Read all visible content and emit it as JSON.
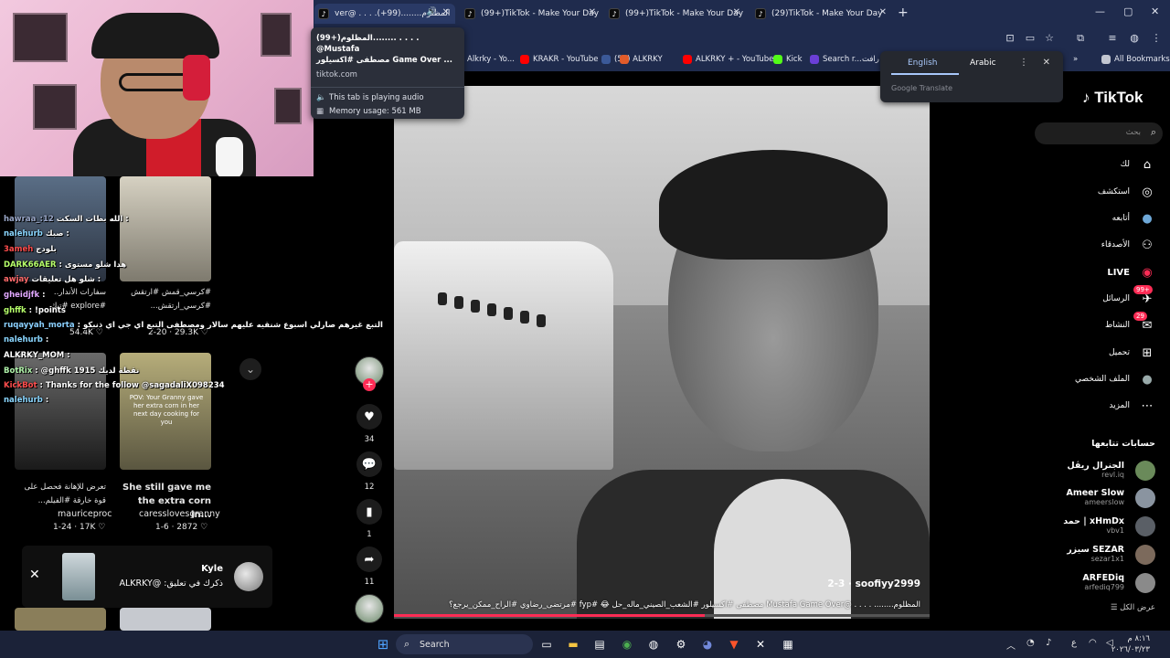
{
  "browser": {
    "tabs": [
      {
        "title": "ver@ . . . .المظلوم........(99+)",
        "active": true
      },
      {
        "title": "(99+)TikTok - Make Your Day"
      },
      {
        "title": "(99+)TikTok - Make Your Day"
      },
      {
        "title": "(29)TikTok - Make Your Day"
      }
    ],
    "new_tab": "+",
    "bookmarks": [
      "Alkrky - Yo...",
      "KRAKR - YouTube",
      "(50) ALKRKY",
      "ALKRKY + - YouTube",
      "Kick",
      "Search r...",
      "رافت",
      "All Bookmarks"
    ],
    "win_controls": [
      "—",
      "▢",
      "✕"
    ]
  },
  "hovercard": {
    "title": "(99+)المظلوم........ . . . . @Mustafa",
    "title2": "مصطفى #اكسيلور Game Over ...",
    "domain": "tiktok.com",
    "audio": "This tab is playing audio",
    "memory": "Memory usage: 561 MB"
  },
  "translate": {
    "lang_from": "English",
    "lang_to": "Arabic",
    "placeholder": "Google Translate",
    "close": "✕",
    "menu": "⋮"
  },
  "chat": [
    {
      "user": "hawraa_:12",
      "user_class": "u1",
      "text": "الله بطات السكت :"
    },
    {
      "user": "nalehurb",
      "user_class": "u2",
      "text": "صبك :"
    },
    {
      "user": "3ameh",
      "user_class": "u3",
      "text": "بلودج"
    },
    {
      "user": "DARK66AER",
      "user_class": "u4",
      "text": ": هدا شلو مستوى"
    },
    {
      "user": "awjay",
      "user_class": "u5",
      "text": "شلو هل تعليقات :"
    },
    {
      "user": "gheidjfk",
      "user_class": "u6",
      "text": ":"
    },
    {
      "user": "ghffk",
      "user_class": "u4",
      "text": ": !points"
    },
    {
      "user": "ruqayyah_morta",
      "user_class": "u9",
      "text": ": التبع غيرهم صارلي اسبوع شنقيه عليهم سالار ومصطفى التبع اي جي اي ذنبكو"
    },
    {
      "user": "nalehurb",
      "user_class": "u2",
      "text": ":"
    },
    {
      "user": "ALKRKY_MOM",
      "user_class": "u7",
      "text": ":"
    },
    {
      "user": "BotRix",
      "user_class": "u8",
      "text": ": @ghffk 1915 نقطة لديك"
    },
    {
      "user": "KickBot",
      "user_class": "u3",
      "text": ": Thanks for the follow @sagadaliX098234"
    },
    {
      "user": "nalehurb",
      "user_class": "u2",
      "text": ":"
    }
  ],
  "grid": {
    "items": [
      {
        "caption": "سفارات الأندار..",
        "caption2": "#explore #تيك",
        "meta": "2-20",
        "likes": "54.4K"
      },
      {
        "caption": "#كرسي_قمش #ارتقش",
        "caption2": "#كرسي_ارتقش...",
        "meta": "2-20",
        "likes": "29.3K"
      },
      {
        "caption": "تعرض للإهانة فحصل على",
        "caption2": "قوة خارقة #الفيلم...",
        "author": "mauriceproc",
        "meta": "1-24",
        "likes": "17K"
      },
      {
        "caption": "She still gave me",
        "caption2": "the extra corn in...",
        "author": "caresslovesgranny",
        "meta": "1-6",
        "likes": "2872"
      }
    ],
    "overlay_text": "POV: Your Granny gave her extra corn in her next day cooking for you"
  },
  "notification": {
    "name": "Kyle",
    "text": "ذكرك في تعليق: @ALKRKY",
    "close": "✕"
  },
  "video": {
    "username": "soofiyy2999",
    "date": "2-3",
    "caption": "المظلوم........ . . . . @Mustafa Game Over مصطفى #اكسيلور #الشعب_الصيني_ماله_حل 😂 #fyp #مرتضى_رضاوي #الراح_ممكن_يرجع؟",
    "progress": 0.58
  },
  "rail": {
    "likes": "34",
    "comments": "12",
    "saves": "1",
    "shares": "11"
  },
  "tiktok": {
    "logo": "TikTok",
    "search_placeholder": "بحث",
    "nav": [
      {
        "label": "لك",
        "icon": "⌂"
      },
      {
        "label": "استكشف",
        "icon": "◎"
      },
      {
        "label": "أتابعه",
        "icon": "●"
      },
      {
        "label": "الأصدقاء",
        "icon": "⚇"
      },
      {
        "label": "LIVE",
        "icon": "◉"
      },
      {
        "label": "الرسائل",
        "icon": "✈",
        "badge": "99+"
      },
      {
        "label": "النشاط",
        "icon": "✉",
        "badge": "29"
      },
      {
        "label": "تحميل",
        "icon": "⊞"
      },
      {
        "label": "الملف الشخصي",
        "icon": "●"
      },
      {
        "label": "المزيد",
        "icon": "⋯"
      }
    ],
    "following_title": "حسابات تتابعها",
    "following": [
      {
        "name": "الجنرال ريڤل",
        "handle": "revl.iq",
        "color": "#6a8a5a"
      },
      {
        "name": "Ameer Slow",
        "handle": "ameerslow",
        "color": "#8a94a0"
      },
      {
        "name": "حمد | xHmDx",
        "handle": "vbv1",
        "color": "#5a5f66"
      },
      {
        "name": "سيزر SEZAR",
        "handle": "sezar1x1",
        "color": "#7c6a5c"
      },
      {
        "name": "ARFEDiq",
        "handle": "arfediq799",
        "color": "#8a8a8a"
      }
    ],
    "see_all": "عرض الكل"
  },
  "taskbar": {
    "search": "Search",
    "clock_time": "٨:١٦ م",
    "clock_date": "٢٠٢٦/٠٣/٢٣",
    "lang": "ع"
  },
  "colors": {
    "accent": "#fe2c55",
    "chrome_bg": "#1f2b4d",
    "taskbar_bg": "#1b2238"
  }
}
